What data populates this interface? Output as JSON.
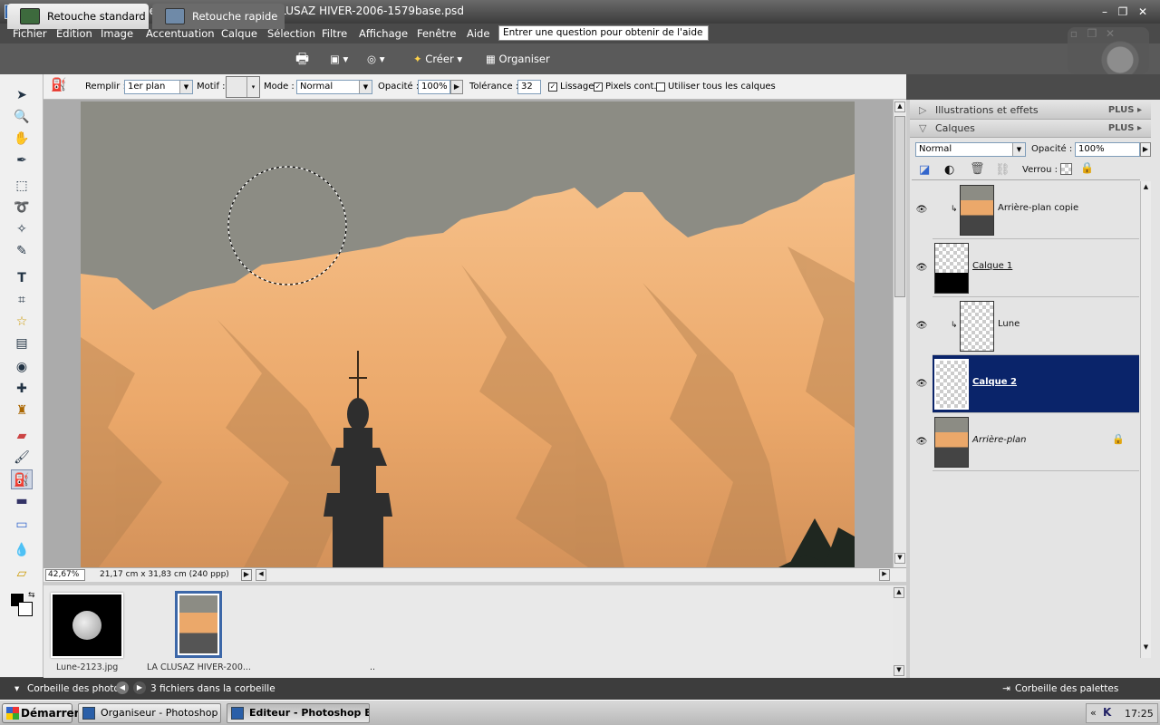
{
  "window": {
    "title": "Adobe Photoshop Elements 5.0 (Editeur) - LA CLUSAZ HIVER-2006-1579base.psd",
    "app_icon": "Ps"
  },
  "menu": [
    "Fichier",
    "Edition",
    "Image",
    "Accentuation",
    "Calque",
    "Sélection",
    "Filtre",
    "Affichage",
    "Fenêtre",
    "Aide"
  ],
  "help_box": "Entrer une question pour obtenir de l'aide",
  "tabs": {
    "standard": "Retouche standard",
    "quick": "Retouche rapide"
  },
  "toolbar": {
    "create": "Créer",
    "organize": "Organiser"
  },
  "options": {
    "fill_label": "Remplir :",
    "fill_value": "1er plan",
    "pattern_label": "Motif :",
    "mode_label": "Mode :",
    "mode_value": "Normal",
    "opacity_label": "Opacité :",
    "opacity_value": "100%",
    "tolerance_label": "Tolérance :",
    "tolerance_value": "32",
    "anti_alias": "Lissage",
    "contiguous": "Pixels cont.",
    "all_layers": "Utiliser tous les calques"
  },
  "status": {
    "zoom": "42,67%",
    "doc_info": "21,17 cm x 31,83 cm (240 ppp)"
  },
  "bin": {
    "items": [
      {
        "name": "Lune-2123.jpg"
      },
      {
        "name": "LA CLUSAZ HIVER-200..."
      }
    ],
    "extra": "..",
    "label": "Corbeille des photos",
    "count": "3 fichiers dans la corbeille",
    "palette_bin": "Corbeille des palettes"
  },
  "panels": {
    "effects": "Illustrations et effets",
    "layers": "Calques",
    "plus": "PLUS",
    "blend_mode": "Normal",
    "opacity_label": "Opacité :",
    "opacity_value": "100%",
    "lock_label": "Verrou :"
  },
  "layers": [
    {
      "name": "Arrière-plan copie",
      "selected": false
    },
    {
      "name": "Calque 1",
      "selected": false
    },
    {
      "name": "Lune",
      "selected": false
    },
    {
      "name": "Calque 2",
      "selected": true
    },
    {
      "name": "Arrière-plan",
      "selected": false
    }
  ],
  "taskbar": {
    "start": "Démarrer",
    "tasks": [
      "Organiseur - Photoshop ...",
      "Editeur - Photoshop El..."
    ],
    "clock": "17:25"
  },
  "colors": {
    "selection_blue": "#0a246a",
    "sky": "#8c8c84",
    "mountain": "#f0a868"
  }
}
